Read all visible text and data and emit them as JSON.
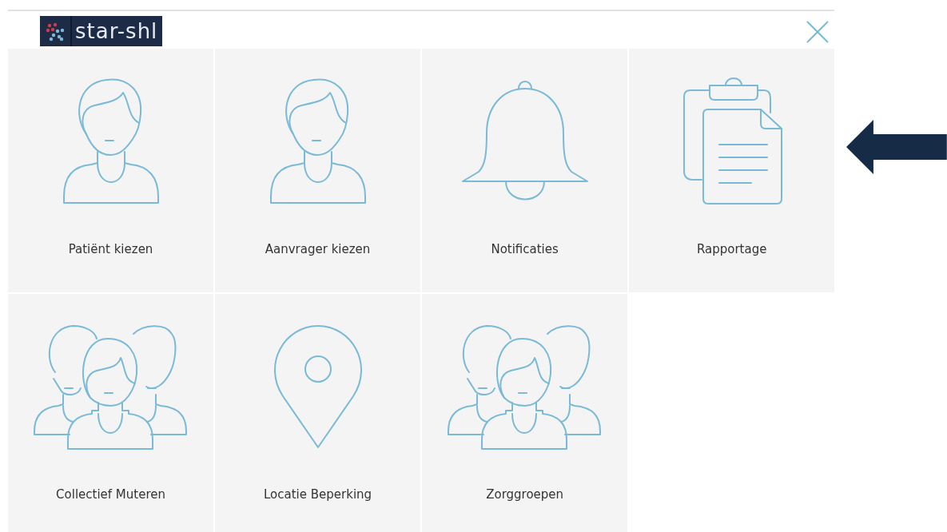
{
  "header": {
    "logo_text": "star-shl"
  },
  "tiles": [
    {
      "label": "Patiënt kiezen",
      "kind": "person"
    },
    {
      "label": "Aanvrager kiezen",
      "kind": "person"
    },
    {
      "label": "Notificaties",
      "kind": "bell"
    },
    {
      "label": "Rapportage",
      "kind": "clipboard"
    },
    {
      "label": "Collectief Muteren",
      "kind": "group"
    },
    {
      "label": "Locatie Beperking",
      "kind": "pin"
    },
    {
      "label": "Zorggroepen",
      "kind": "group"
    }
  ]
}
